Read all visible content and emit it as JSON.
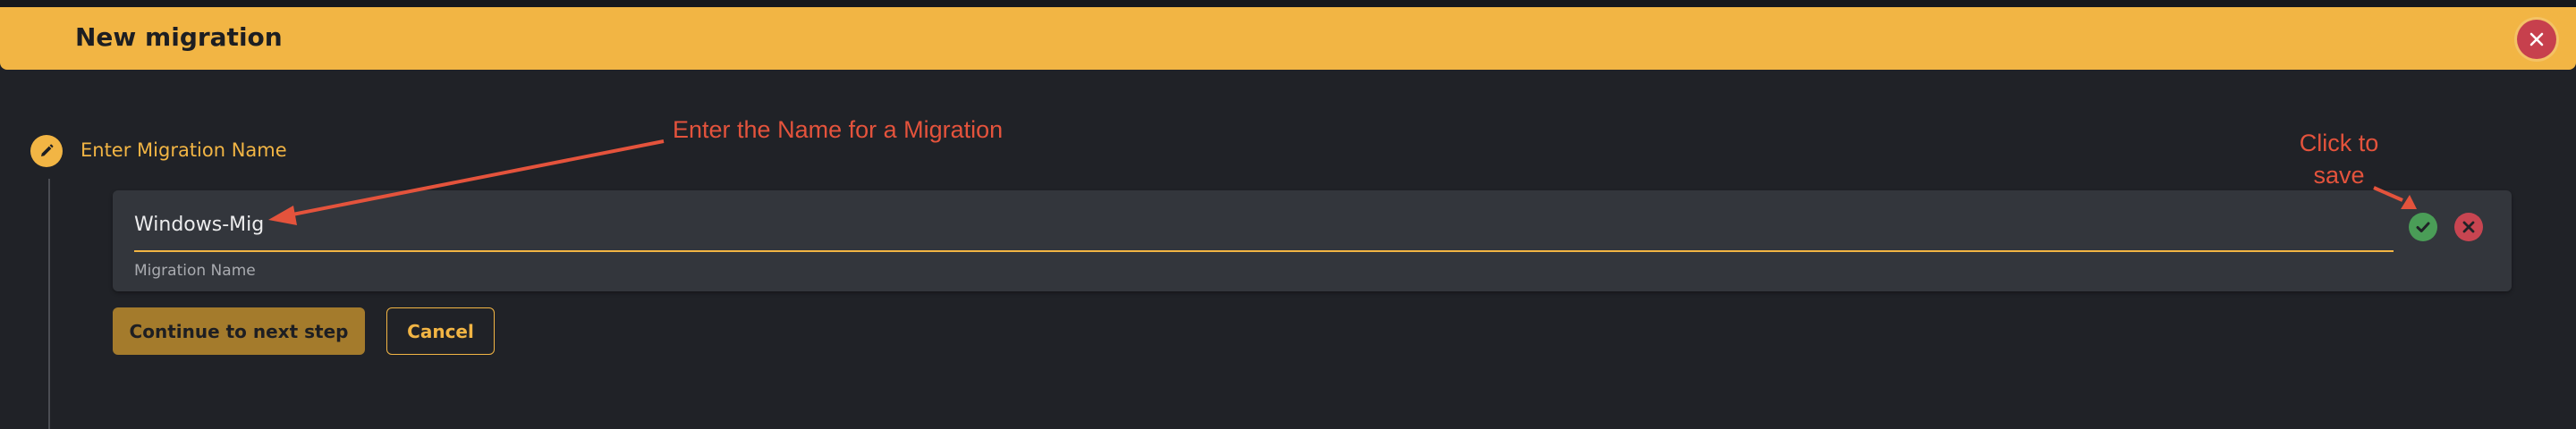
{
  "dialog": {
    "title": "New migration"
  },
  "step": {
    "label": "Enter Migration Name"
  },
  "field": {
    "value": "Windows-Mig",
    "hint": "Migration Name"
  },
  "buttons": {
    "continue": "Continue to next step",
    "cancel": "Cancel"
  },
  "annotations": {
    "name_note": "Enter the Name for a Migration",
    "save_note": "Click to save"
  },
  "icons": {
    "close": "close-icon",
    "step": "pencil-icon",
    "confirm": "check-icon",
    "discard": "x-icon"
  },
  "colors": {
    "accent": "#f2b544",
    "background": "#202227",
    "card": "#33363c",
    "annotation": "#e4533c",
    "confirm": "#4a9d57",
    "discard": "#c84551"
  }
}
